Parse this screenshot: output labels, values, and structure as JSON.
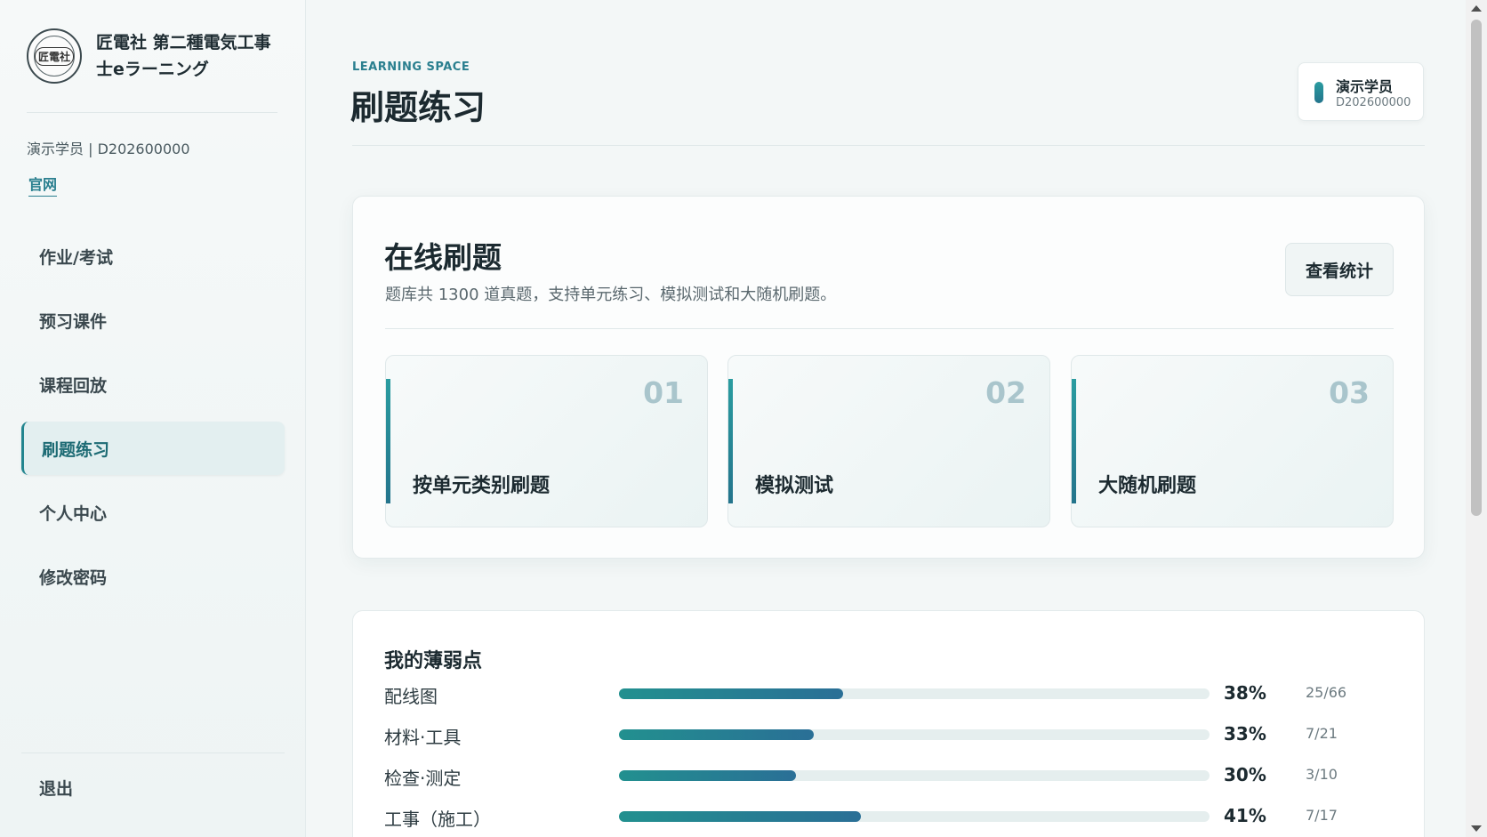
{
  "brand": {
    "name_line1": "匠電社 第二種電気工事",
    "name_line2": "士eラーニング",
    "logo_text": "匠電社"
  },
  "sidebar": {
    "user_line": "演示学员 | D202600000",
    "site_link": "官网",
    "items": [
      {
        "label": "作业/考试"
      },
      {
        "label": "预习课件"
      },
      {
        "label": "课程回放"
      },
      {
        "label": "刷题练习"
      },
      {
        "label": "个人中心"
      },
      {
        "label": "修改密码"
      }
    ],
    "active_index": 3,
    "logout": "退出"
  },
  "header": {
    "eyebrow": "LEARNING SPACE",
    "title": "刷题练习",
    "user_name": "演示学员",
    "user_id": "D202600000"
  },
  "practice": {
    "title": "在线刷题",
    "subtitle": "题库共 1300 道真题，支持单元练习、模拟测试和大随机刷题。",
    "stats_button": "查看统计",
    "options": [
      {
        "num": "01",
        "label": "按单元类别刷题"
      },
      {
        "num": "02",
        "label": "模拟测试"
      },
      {
        "num": "03",
        "label": "大随机刷题"
      }
    ]
  },
  "weak_points": {
    "title": "我的薄弱点",
    "rows": [
      {
        "name": "配线图",
        "percent": "38%",
        "ratio": 0.38,
        "count": "25/66"
      },
      {
        "name": "材料·工具",
        "percent": "33%",
        "ratio": 0.33,
        "count": "7/21"
      },
      {
        "name": "检查·测定",
        "percent": "30%",
        "ratio": 0.3,
        "count": "3/10"
      },
      {
        "name": "工事（施工）",
        "percent": "41%",
        "ratio": 0.41,
        "count": "7/17"
      }
    ]
  },
  "colors": {
    "accent": "#22858f",
    "bar_start": "#22908f",
    "bar_end": "#2a6f96"
  }
}
